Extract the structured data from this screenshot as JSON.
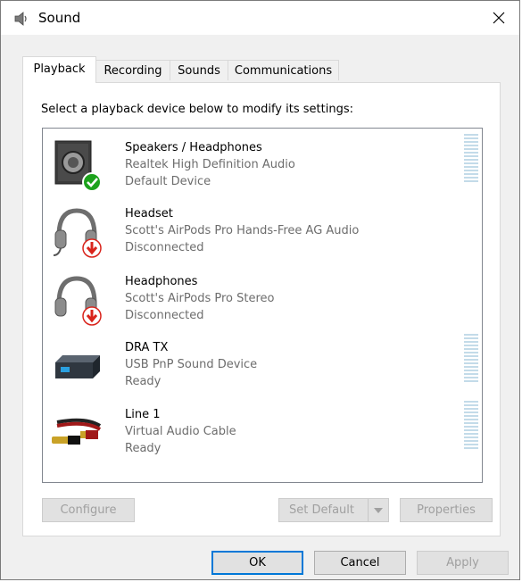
{
  "window": {
    "title": "Sound",
    "close_glyph": "✕"
  },
  "tabs": [
    {
      "label": "Playback",
      "active": true
    },
    {
      "label": "Recording",
      "active": false
    },
    {
      "label": "Sounds",
      "active": false
    },
    {
      "label": "Communications",
      "active": false
    }
  ],
  "panel": {
    "instruction": "Select a playback device below to modify its settings:",
    "devices": [
      {
        "name": "Speakers / Headphones",
        "description": "Realtek High Definition Audio",
        "status": "Default Device",
        "icon": "speaker-default-icon",
        "has_meter": true
      },
      {
        "name": "Headset",
        "description": "Scott's AirPods Pro Hands-Free AG Audio",
        "status": "Disconnected",
        "icon": "headset-disconnected-icon",
        "has_meter": false
      },
      {
        "name": "Headphones",
        "description": "Scott's AirPods Pro Stereo",
        "status": "Disconnected",
        "icon": "headphones-disconnected-icon",
        "has_meter": false
      },
      {
        "name": "DRA TX",
        "description": "USB PnP Sound Device",
        "status": "Ready",
        "icon": "usb-sound-device-icon",
        "has_meter": true
      },
      {
        "name": "Line 1",
        "description": "Virtual Audio Cable",
        "status": "Ready",
        "icon": "audio-cable-icon",
        "has_meter": true
      }
    ],
    "buttons": {
      "configure": "Configure",
      "set_default": "Set Default",
      "properties": "Properties"
    }
  },
  "footer": {
    "ok": "OK",
    "cancel": "Cancel",
    "apply": "Apply"
  },
  "colors": {
    "accent": "#0078d7",
    "check_green": "#1ca21c",
    "disconnect_red": "#d9241c",
    "meter": "#c3dbe9"
  }
}
